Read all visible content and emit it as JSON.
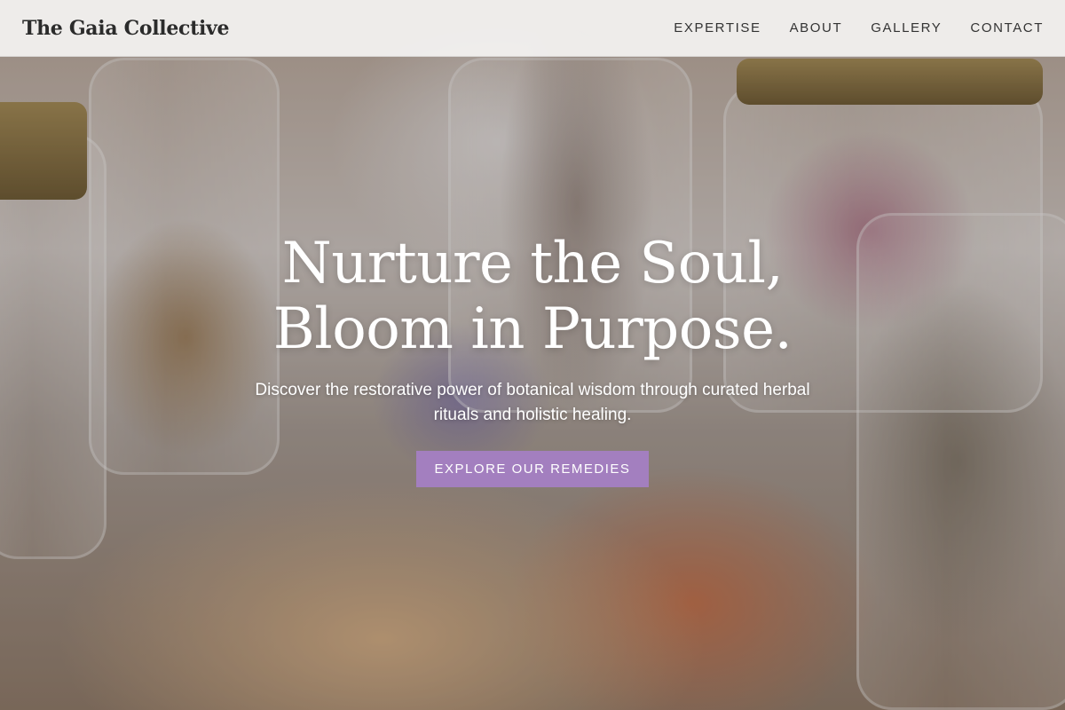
{
  "header": {
    "brand": "The Gaia Collective",
    "nav": [
      {
        "label": "EXPERTISE"
      },
      {
        "label": "ABOUT"
      },
      {
        "label": "GALLERY"
      },
      {
        "label": "CONTACT"
      }
    ]
  },
  "hero": {
    "title_line1": "Nurture the Soul,",
    "title_line2": "Bloom in Purpose.",
    "subtitle": "Discover the restorative power of botanical wisdom through curated herbal rituals and holistic healing.",
    "cta_label": "EXPLORE OUR REMEDIES",
    "background_image": "herbal jars, dried roots, lavender and rose buds on a table"
  },
  "colors": {
    "accent": "#a37fbf",
    "header_bg": "#f4f3f2",
    "brand_text": "#2b2b2b",
    "hero_text": "#ffffff"
  }
}
